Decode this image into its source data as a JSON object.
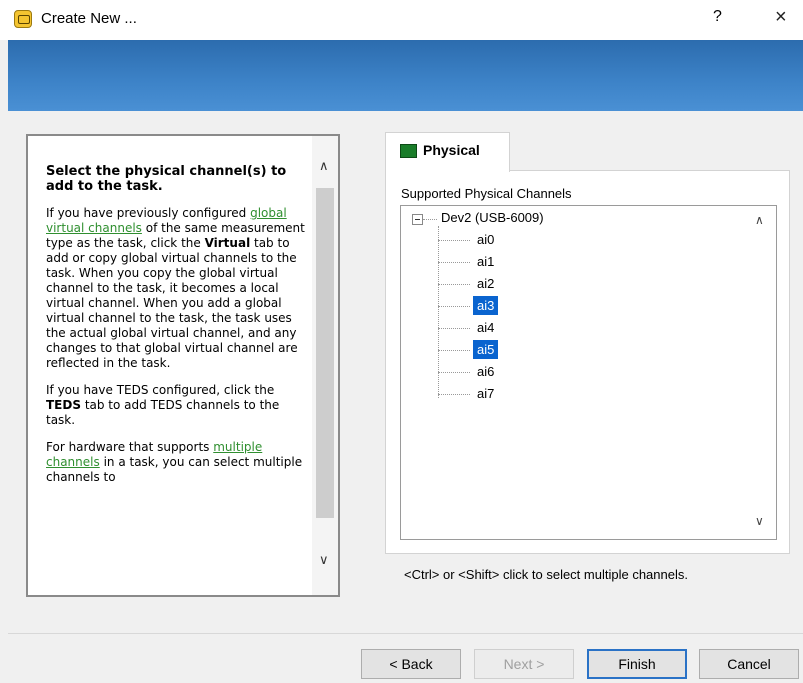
{
  "window": {
    "title": "Create New ...",
    "help_glyph": "?",
    "close_glyph": "×"
  },
  "help": {
    "heading": "Select the physical channel(s) to add to the task.",
    "p1_a": "If you have previously configured ",
    "p1_link": "global virtual channels",
    "p1_b": " of the same measurement type as the task, click the ",
    "p1_bold": "Virtual",
    "p1_c": " tab to add or copy global virtual channels to the task. When you copy the global virtual channel to the task, it becomes a local virtual channel. When you add a global virtual channel to the task, the task uses the actual global virtual channel, and any changes to that global virtual channel are reflected in the task.",
    "p2_a": "If you have TEDS configured, click the ",
    "p2_bold": "TEDS",
    "p2_b": " tab to add TEDS channels to the task.",
    "p3_a": "For hardware that supports ",
    "p3_link": "multiple channels",
    "p3_b": " in a task, you can select multiple channels to"
  },
  "tab": {
    "label": "Physical",
    "icon": "daq-device-icon"
  },
  "channels": {
    "label": "Supported Physical Channels",
    "device": "Dev2  (USB-6009)",
    "items": [
      {
        "name": "ai0",
        "selected": false
      },
      {
        "name": "ai1",
        "selected": false
      },
      {
        "name": "ai2",
        "selected": false
      },
      {
        "name": "ai3",
        "selected": true
      },
      {
        "name": "ai4",
        "selected": false
      },
      {
        "name": "ai5",
        "selected": true
      },
      {
        "name": "ai6",
        "selected": false
      },
      {
        "name": "ai7",
        "selected": false
      }
    ]
  },
  "hint": "<Ctrl> or <Shift> click to select multiple channels.",
  "buttons": {
    "back": "< Back",
    "next": "Next >",
    "finish": "Finish",
    "cancel": "Cancel"
  }
}
